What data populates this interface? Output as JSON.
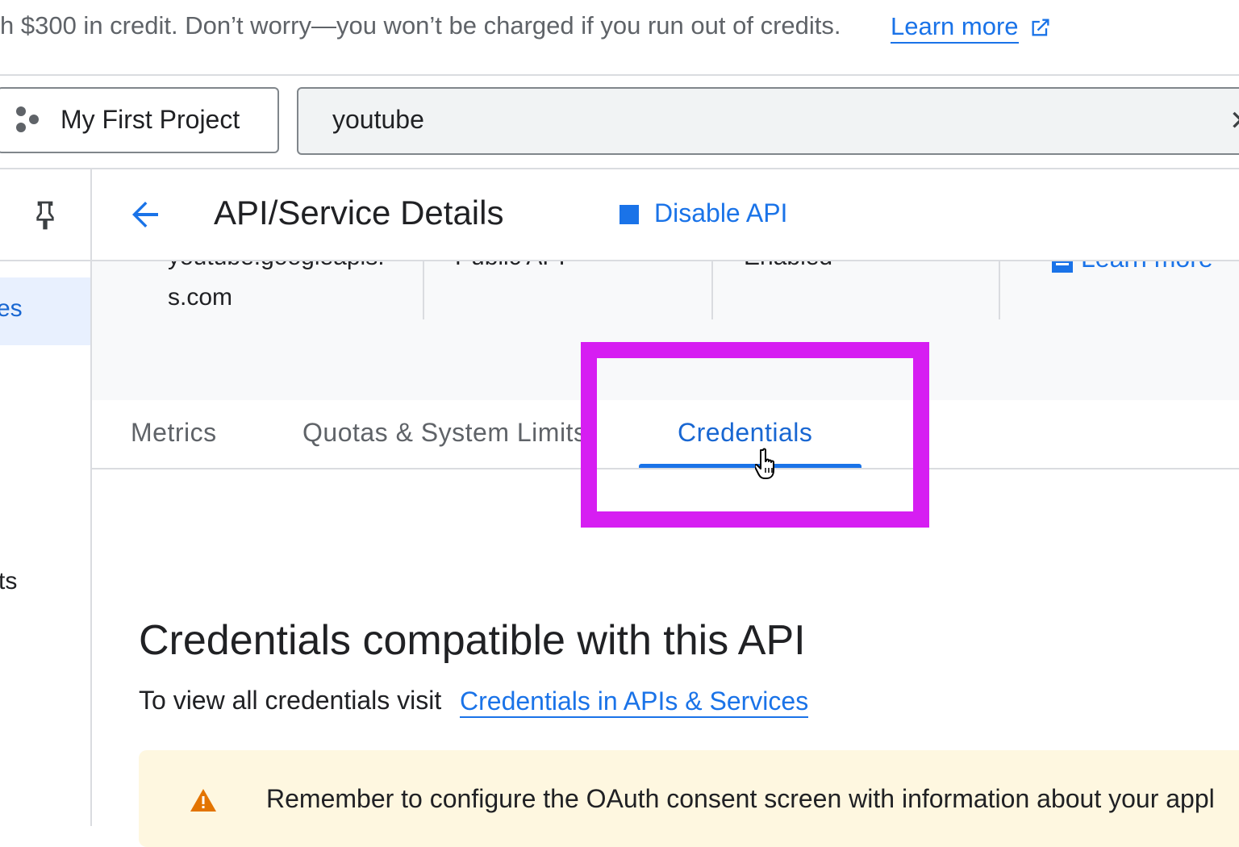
{
  "banner": {
    "text": "h $300 in credit. Don’t worry—you won’t be charged if you run out of credits.",
    "link": "Learn more"
  },
  "topbar": {
    "project": "My First Project",
    "search_value": "youtube",
    "clear_glyph": "✕"
  },
  "sidenav": {
    "active_label": "es",
    "item_2_label": "ts"
  },
  "header": {
    "title": "API/Service Details",
    "disable_label": "Disable API"
  },
  "details": {
    "email_top": "youtube.googleapis.",
    "email_bottom": "s.com",
    "type": "Public API",
    "status": "Enabled",
    "learn_more": "Learn more"
  },
  "tabs": [
    {
      "label": "Metrics",
      "active": false
    },
    {
      "label": "Quotas & System Limits",
      "active": false
    },
    {
      "label": "Credentials",
      "active": true
    }
  ],
  "content": {
    "title": "Credentials compatible with this API",
    "subtitle": "To view all credentials visit",
    "link": "Credentials in APIs & Services"
  },
  "warning": {
    "text": "Remember to configure the OAuth consent screen with information about your appl"
  },
  "colors": {
    "accent": "#1a73e8",
    "highlight": "#d61ef2",
    "warning_bg": "#fef7e0",
    "warning_icon": "#e37400"
  },
  "icons": {
    "project": "project-hexagon-icon",
    "pin": "pin-icon",
    "back": "arrow-left-icon",
    "disable": "stop-square-icon",
    "external": "external-link-icon",
    "warning": "warning-triangle-icon",
    "cursor": "hand-pointer-icon"
  }
}
